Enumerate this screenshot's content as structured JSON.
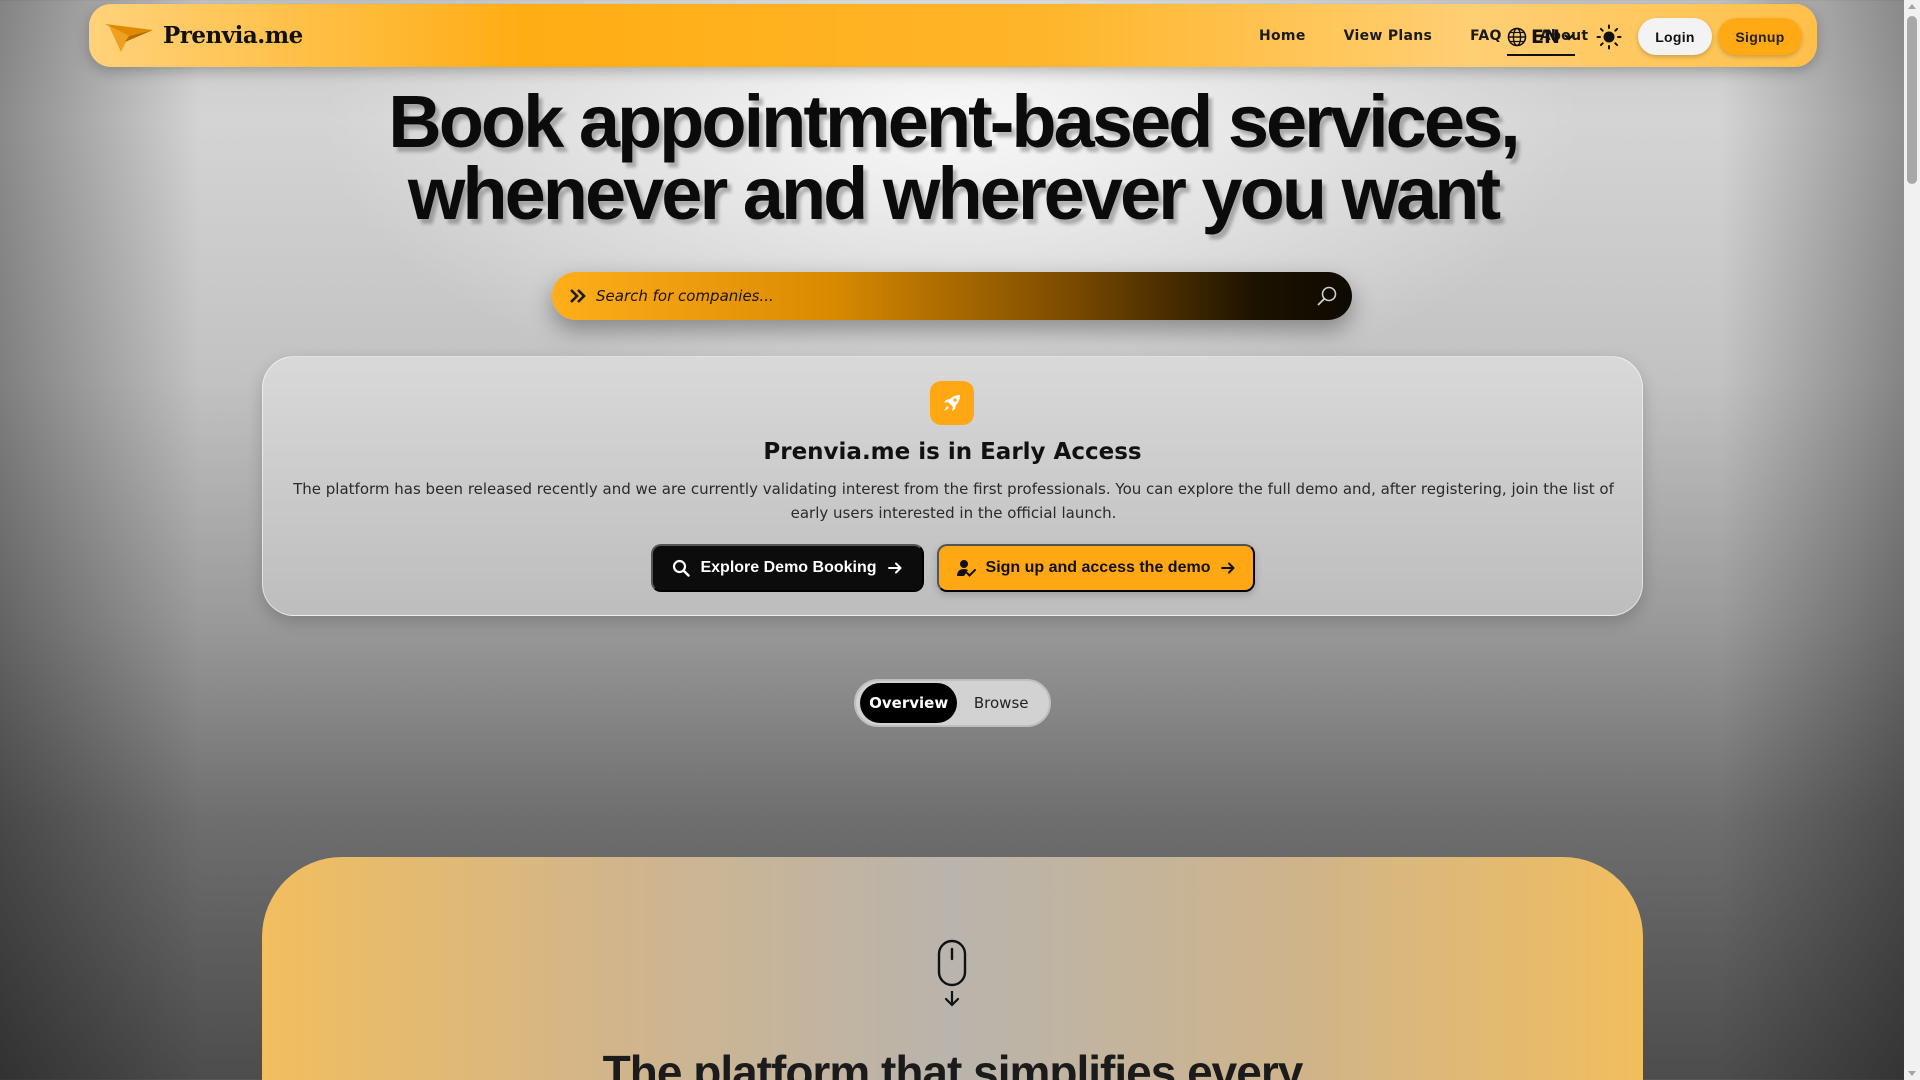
{
  "brand": {
    "name": "Prenvia.me"
  },
  "nav": {
    "links": [
      "Home",
      "View Plans",
      "FAQ",
      "About"
    ],
    "language": "EN",
    "login_label": "Login",
    "signup_label": "Signup"
  },
  "hero": {
    "title_line1": "Book appointment-based services,",
    "title_line2": "whenever and wherever you want"
  },
  "search": {
    "placeholder": "Search for companies..."
  },
  "early_access": {
    "title": "Prenvia.me is in Early Access",
    "text": "The platform has been released recently and we are currently validating interest from the first professionals. You can explore the full demo and, after registering, join the list of early users interested in the official launch.",
    "demo_button": "Explore Demo Booking",
    "signup_button": "Sign up and access the demo"
  },
  "tabs": {
    "overview": "Overview",
    "browse": "Browse"
  },
  "section": {
    "heading": "The platform that simplifies every"
  },
  "colors": {
    "accent": "#ffa814",
    "dark": "#0c0c0c"
  }
}
